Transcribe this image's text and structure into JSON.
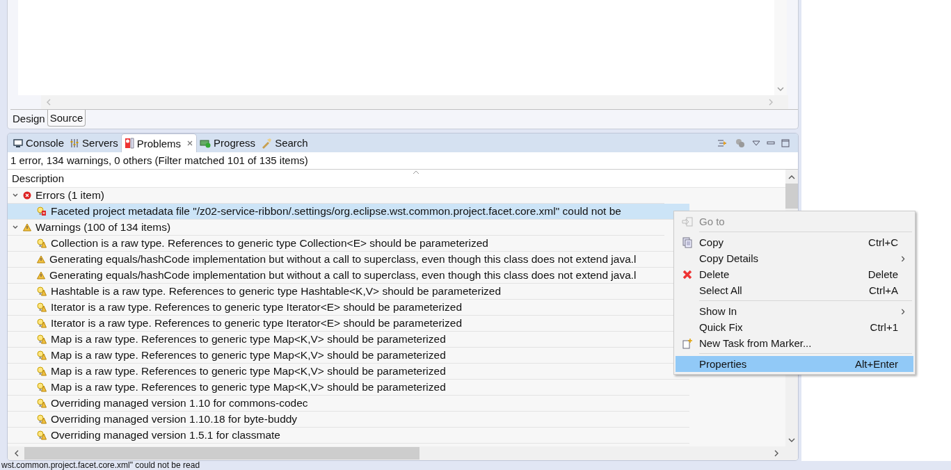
{
  "editor": {
    "tabs": [
      {
        "label": "Design",
        "selected": false
      },
      {
        "label": "Source",
        "selected": true
      }
    ]
  },
  "problems_view": {
    "tabs": [
      {
        "label": "Console",
        "selected": false
      },
      {
        "label": "Servers",
        "selected": false
      },
      {
        "label": "Problems",
        "selected": true
      },
      {
        "label": "Progress",
        "selected": false
      },
      {
        "label": "Search",
        "selected": false
      }
    ],
    "summary": "1 error, 134 warnings, 0 others (Filter matched 101 of 135 items)",
    "column": "Description",
    "tree": [
      {
        "label": "Errors (1 item)",
        "kind": "error",
        "expanded": true,
        "children": [
          {
            "label": "Faceted project metadata file \"/z02-service-ribbon/.settings/org.eclipse.wst.common.project.facet.core.xml\" could not be",
            "kind": "quickfix-error",
            "selected": true
          }
        ]
      },
      {
        "label": "Warnings (100 of 134 items)",
        "kind": "warning",
        "expanded": true,
        "children": [
          {
            "label": "Collection is a raw type. References to generic type Collection<E> should be parameterized",
            "kind": "quickfix-warning",
            "selected": false
          },
          {
            "label": "Generating equals/hashCode implementation but without a call to superclass, even though this class does not extend java.l",
            "kind": "warning",
            "selected": false
          },
          {
            "label": "Generating equals/hashCode implementation but without a call to superclass, even though this class does not extend java.l",
            "kind": "warning",
            "selected": false
          },
          {
            "label": "Hashtable is a raw type. References to generic type Hashtable<K,V> should be parameterized",
            "kind": "quickfix-warning",
            "selected": false
          },
          {
            "label": "Iterator is a raw type. References to generic type Iterator<E> should be parameterized",
            "kind": "quickfix-warning",
            "selected": false
          },
          {
            "label": "Iterator is a raw type. References to generic type Iterator<E> should be parameterized",
            "kind": "quickfix-warning",
            "selected": false
          },
          {
            "label": "Map is a raw type. References to generic type Map<K,V> should be parameterized",
            "kind": "quickfix-warning",
            "selected": false
          },
          {
            "label": "Map is a raw type. References to generic type Map<K,V> should be parameterized",
            "kind": "quickfix-warning",
            "selected": false
          },
          {
            "label": "Map is a raw type. References to generic type Map<K,V> should be parameterized",
            "kind": "quickfix-warning",
            "selected": false
          },
          {
            "label": "Map is a raw type. References to generic type Map<K,V> should be parameterized",
            "kind": "quickfix-warning",
            "selected": false
          },
          {
            "label": "Overriding managed version 1.10 for commons-codec",
            "kind": "quickfix-warning",
            "selected": false
          },
          {
            "label": "Overriding managed version 1.10.18 for byte-buddy",
            "kind": "quickfix-warning",
            "selected": false
          },
          {
            "label": "Overriding managed version 1.5.1 for classmate",
            "kind": "quickfix-warning",
            "selected": false
          }
        ]
      }
    ]
  },
  "context_menu": [
    {
      "kind": "item",
      "label": "Go to",
      "disabled": true,
      "selected": false
    },
    {
      "kind": "separator"
    },
    {
      "kind": "item",
      "label": "Copy",
      "shortcut": "Ctrl+C",
      "disabled": false,
      "selected": false
    },
    {
      "kind": "item",
      "label": "Copy Details",
      "submenu": "›",
      "disabled": false,
      "selected": false
    },
    {
      "kind": "item",
      "label": "Delete",
      "shortcut": "Delete",
      "disabled": false,
      "selected": false
    },
    {
      "kind": "item",
      "label": "Select All",
      "shortcut": "Ctrl+A",
      "disabled": false,
      "selected": false
    },
    {
      "kind": "separator"
    },
    {
      "kind": "item",
      "label": "Show In",
      "submenu": "›",
      "disabled": false,
      "selected": false
    },
    {
      "kind": "item",
      "label": "Quick Fix",
      "shortcut": "Ctrl+1",
      "disabled": false,
      "selected": false
    },
    {
      "kind": "item",
      "label": "New Task from Marker...",
      "disabled": false,
      "selected": false
    },
    {
      "kind": "separator"
    },
    {
      "kind": "item",
      "label": "Properties",
      "shortcut": "Alt+Enter",
      "disabled": false,
      "selected": true
    }
  ],
  "status_bar": {
    "message": "wst.common.project.facet.core.xml\" could not be read"
  }
}
